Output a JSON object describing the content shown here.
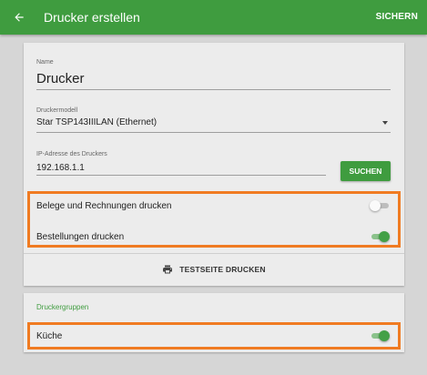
{
  "appbar": {
    "title": "Drucker erstellen",
    "save_label": "SICHERN",
    "back_icon": "arrow-left-icon"
  },
  "form": {
    "name_label": "Name",
    "name_value": "Drucker",
    "model_label": "Druckermodell",
    "model_value": "Star TSP143IIILAN (Ethernet)",
    "ip_label": "IP-Adresse des Druckers",
    "ip_value": "192.168.1.1",
    "search_label": "SUCHEN"
  },
  "toggles": [
    {
      "label": "Belege und Rechnungen drucken",
      "checked": false
    },
    {
      "label": "Bestellungen drucken",
      "checked": true
    }
  ],
  "testprint": {
    "label": "TESTSEITE DRUCKEN",
    "icon": "printer-icon"
  },
  "groups": {
    "title": "Druckergruppen",
    "items": [
      {
        "label": "Küche",
        "checked": true
      }
    ]
  },
  "colors": {
    "primary": "#3f9c3f",
    "highlight": "#f07b22",
    "background": "#d6d6d6",
    "card": "#ececec"
  }
}
